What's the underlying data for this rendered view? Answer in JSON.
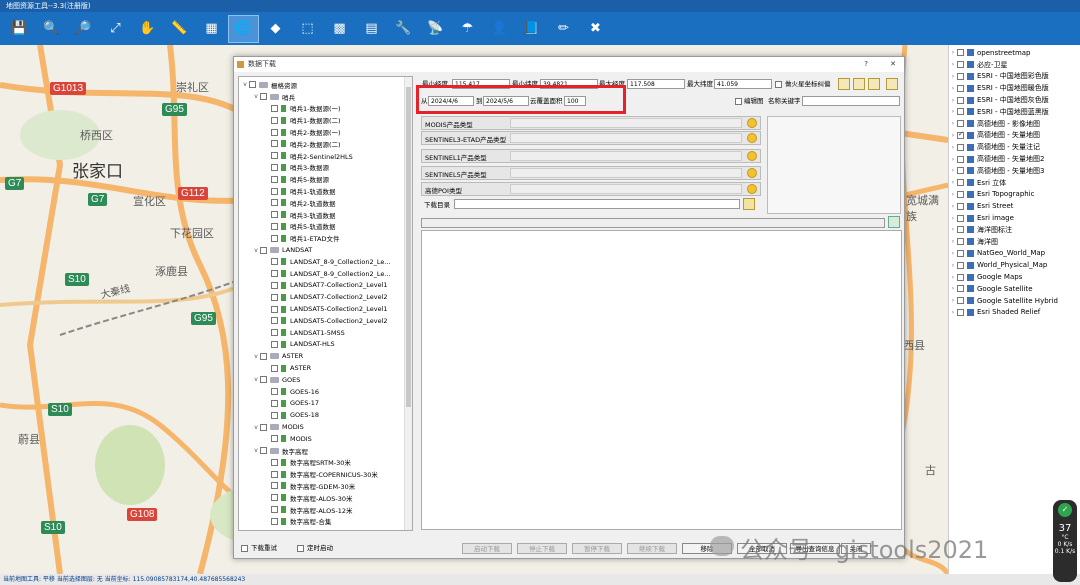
{
  "window": {
    "title": "地图资源工具--3.3(注册版)"
  },
  "toolbar": {
    "buttons": [
      {
        "icon": "save-icon",
        "glyph": "💾"
      },
      {
        "icon": "zoom-in-icon",
        "glyph": "🔍"
      },
      {
        "icon": "zoom-out-icon",
        "glyph": "🔎"
      },
      {
        "icon": "full-extent-icon",
        "glyph": "⤢"
      },
      {
        "icon": "pan-hand-icon",
        "glyph": "✋"
      },
      {
        "icon": "measure-ruler-icon",
        "glyph": "📏"
      },
      {
        "icon": "measure-area-icon",
        "glyph": "▦"
      },
      {
        "icon": "download-globe-icon",
        "glyph": "🌐"
      },
      {
        "icon": "green-diamond-icon",
        "glyph": "◆"
      },
      {
        "icon": "select-rectangle-icon",
        "glyph": "⬚"
      },
      {
        "icon": "grid-icon",
        "glyph": "▩"
      },
      {
        "icon": "layer-icon",
        "glyph": "▤"
      },
      {
        "icon": "tools-icon",
        "glyph": "🔧"
      },
      {
        "icon": "satellite-icon",
        "glyph": "📡"
      },
      {
        "icon": "umbrella-icon",
        "glyph": "☂"
      },
      {
        "icon": "user-icon",
        "glyph": "👤"
      },
      {
        "icon": "book-icon",
        "glyph": "📘"
      },
      {
        "icon": "pencil-icon",
        "glyph": "✏"
      },
      {
        "icon": "close-red-icon",
        "glyph": "✖"
      }
    ]
  },
  "map": {
    "cities": [
      "崇礼区",
      "桥西区",
      "张家口",
      "宣化区",
      "下花园区",
      "涿鹿县",
      "西县",
      "蔚县",
      "古"
    ],
    "roads": [
      "G1013",
      "G95",
      "G7",
      "G7",
      "G112",
      "S10",
      "G95",
      "S10",
      "S10",
      "G108",
      "大秦线"
    ],
    "right_labels": [
      "宽城满族"
    ]
  },
  "layers": {
    "items": [
      {
        "label": "openstreetmap",
        "checked": false
      },
      {
        "label": "必应-卫星",
        "checked": false
      },
      {
        "label": "ESRI - 中国地图彩色版",
        "checked": false
      },
      {
        "label": "ESRI - 中国地图暖色版",
        "checked": false
      },
      {
        "label": "ESRI - 中国地图灰色版",
        "checked": false
      },
      {
        "label": "ESRI - 中国地图蓝黑版",
        "checked": false
      },
      {
        "label": "高德地图 - 影像地图",
        "checked": false
      },
      {
        "label": "高德地图 - 矢量地图",
        "checked": true
      },
      {
        "label": "高德地图 - 矢量注记",
        "checked": false
      },
      {
        "label": "高德地图 - 矢量地图2",
        "checked": false
      },
      {
        "label": "高德地图 - 矢量地图3",
        "checked": false
      },
      {
        "label": "Esri 立体",
        "checked": false
      },
      {
        "label": "Esri Topographic",
        "checked": false
      },
      {
        "label": "Esri Street",
        "checked": false
      },
      {
        "label": "Esri image",
        "checked": false
      },
      {
        "label": "海洋图标注",
        "checked": false
      },
      {
        "label": "海洋图",
        "checked": false
      },
      {
        "label": "NatGeo_World_Map",
        "checked": false
      },
      {
        "label": "World_Physical_Map",
        "checked": false
      },
      {
        "label": "Google Maps",
        "checked": false
      },
      {
        "label": "Google Satellite",
        "checked": false
      },
      {
        "label": "Google Satellite Hybrid",
        "checked": false
      },
      {
        "label": "Esri Shaded Relief",
        "checked": false
      }
    ]
  },
  "dialog": {
    "title": "数据下载",
    "help": "?",
    "close": "✕",
    "tree": [
      {
        "label": "栅格资源",
        "level": 0,
        "type": "folder",
        "caret": "v"
      },
      {
        "label": "哨兵",
        "level": 1,
        "type": "folder",
        "caret": "v"
      },
      {
        "label": "哨兵1-数据源(一)",
        "level": 2,
        "type": "leaf"
      },
      {
        "label": "哨兵1-数据源(二)",
        "level": 2,
        "type": "leaf"
      },
      {
        "label": "哨兵2-数据源(一)",
        "level": 2,
        "type": "leaf"
      },
      {
        "label": "哨兵2-数据源(二)",
        "level": 2,
        "type": "leaf"
      },
      {
        "label": "哨兵2-Sentinel2HLS",
        "level": 2,
        "type": "leaf"
      },
      {
        "label": "哨兵3-数据源",
        "level": 2,
        "type": "leaf"
      },
      {
        "label": "哨兵5-数据源",
        "level": 2,
        "type": "leaf"
      },
      {
        "label": "哨兵1-轨道数据",
        "level": 2,
        "type": "leaf"
      },
      {
        "label": "哨兵2-轨道数据",
        "level": 2,
        "type": "leaf"
      },
      {
        "label": "哨兵3-轨道数据",
        "level": 2,
        "type": "leaf"
      },
      {
        "label": "哨兵5-轨道数据",
        "level": 2,
        "type": "leaf"
      },
      {
        "label": "哨兵1-ETAD文件",
        "level": 2,
        "type": "leaf"
      },
      {
        "label": "LANDSAT",
        "level": 1,
        "type": "folder",
        "caret": "v"
      },
      {
        "label": "LANDSAT_8-9_Collection2_Le...",
        "level": 2,
        "type": "leaf"
      },
      {
        "label": "LANDSAT_8-9_Collection2_Le...",
        "level": 2,
        "type": "leaf"
      },
      {
        "label": "LANDSAT7-Collection2_Level1",
        "level": 2,
        "type": "leaf"
      },
      {
        "label": "LANDSAT7-Collection2_Level2",
        "level": 2,
        "type": "leaf"
      },
      {
        "label": "LANDSAT5-Collection2_Level1",
        "level": 2,
        "type": "leaf"
      },
      {
        "label": "LANDSAT5-Collection2_Level2",
        "level": 2,
        "type": "leaf"
      },
      {
        "label": "LANDSAT1-5MSS",
        "level": 2,
        "type": "leaf"
      },
      {
        "label": "LANDSAT-HLS",
        "level": 2,
        "type": "leaf"
      },
      {
        "label": "ASTER",
        "level": 1,
        "type": "folder",
        "caret": "v"
      },
      {
        "label": "ASTER",
        "level": 2,
        "type": "leaf"
      },
      {
        "label": "GOES",
        "level": 1,
        "type": "folder",
        "caret": "v"
      },
      {
        "label": "GOES-16",
        "level": 2,
        "type": "leaf"
      },
      {
        "label": "GOES-17",
        "level": 2,
        "type": "leaf"
      },
      {
        "label": "GOES-18",
        "level": 2,
        "type": "leaf"
      },
      {
        "label": "MODIS",
        "level": 1,
        "type": "folder",
        "caret": "v"
      },
      {
        "label": "MODIS",
        "level": 2,
        "type": "leaf"
      },
      {
        "label": "数字高程",
        "level": 1,
        "type": "folder",
        "caret": "v"
      },
      {
        "label": "数字高程SRTM-30米",
        "level": 2,
        "type": "leaf"
      },
      {
        "label": "数字高程-COPERNICUS-30米",
        "level": 2,
        "type": "leaf"
      },
      {
        "label": "数字高程-GDEM-30米",
        "level": 2,
        "type": "leaf"
      },
      {
        "label": "数字高程-ALOS-30米",
        "level": 2,
        "type": "leaf"
      },
      {
        "label": "数字高程-ALOS-12米",
        "level": 2,
        "type": "leaf"
      },
      {
        "label": "数字高程-合集",
        "level": 2,
        "type": "leaf"
      }
    ],
    "form": {
      "min_lon_label": "最小经度",
      "min_lon_value": "115.417",
      "min_lat_label": "最小纬度",
      "min_lat_value": "39.4821",
      "max_lon_label": "最大经度",
      "max_lon_value": "117.508",
      "max_lat_label": "最大纬度",
      "max_lat_value": "41.059",
      "mars_label": "做火星坐标纠偏",
      "from_label": "从",
      "from_date": "2024/4/6",
      "to_label": "到",
      "to_date": "2024/5/6",
      "cloud_label": "云覆盖面积",
      "cloud_value": "100",
      "edit_map_label": "编辑图",
      "keyword_label": "名称关键字",
      "rows": [
        "MODIS产品类型",
        "SENTINEL3-ETAD产品类型",
        "SENTINEL1产品类型",
        "SENTINEL5产品类型",
        "高德POI类型"
      ],
      "dir_label": "下载目录"
    },
    "bottom": {
      "retry_label": "下载重试",
      "timer_label": "定时启动",
      "buttons": [
        "启动下载",
        "停止下载",
        "暂停下载",
        "继续下载",
        "移除",
        "全部取消",
        "导出查询信息",
        "关闭"
      ]
    }
  },
  "status": {
    "text": "当前地图工具: 平移  当前选择图层: 无  当前坐标: 115.09085783174,40.487685568243"
  },
  "watermark": {
    "text": "公众号 · gistools2021"
  },
  "gauge": {
    "value": "37",
    "unit": "°C",
    "up": "0 K/s",
    "down": "0.1 K/s"
  }
}
